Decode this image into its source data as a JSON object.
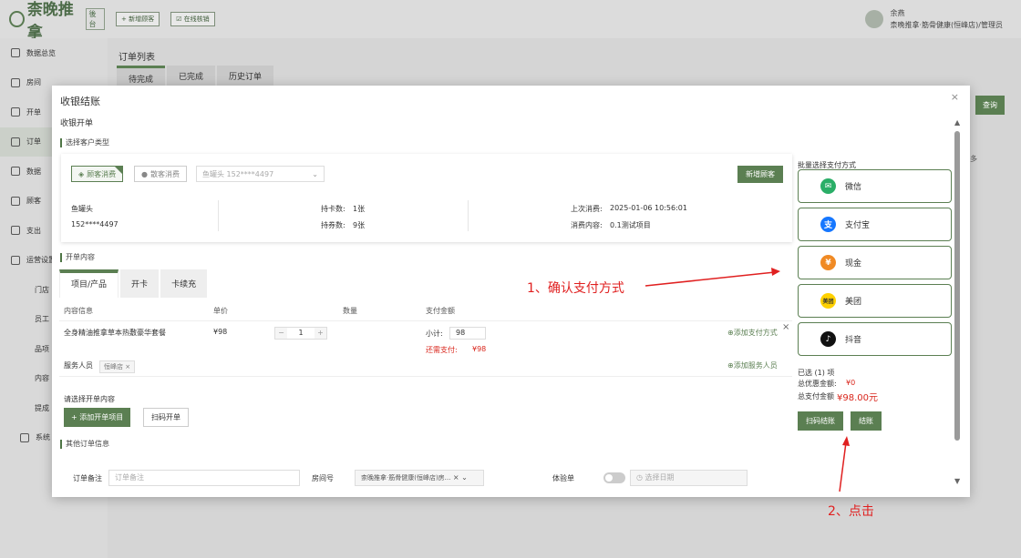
{
  "app": {
    "logo": "柰晚推拿",
    "logo_small": "後台",
    "new_customer": "+ 新增顾客",
    "online_verify": "☑ 在线核销"
  },
  "user": {
    "name": "余燕",
    "store": "柰晚推拿·筋骨健康(恒峰店)/管理员"
  },
  "sidebar": [
    "数据总览",
    "房间",
    "开单",
    "订单",
    "数据",
    "顾客",
    "支出",
    "运营设置",
    "门店",
    "员工",
    "品项",
    "内容",
    "提成",
    "系统"
  ],
  "bg": {
    "title": "订单列表",
    "tabs": [
      "待完成",
      "已完成",
      "历史订单"
    ],
    "query": "查询",
    "dup": "多"
  },
  "modal": {
    "title": "收银结账",
    "close": "×",
    "subtitle": "收银开单",
    "sec_customer": "选择客户类型",
    "member_btn": "顾客消费",
    "guest_btn": "散客消费",
    "customer_select": "鱼罐头 152****4497",
    "new_customer": "新增顾客",
    "cust_name": "鱼罐头",
    "cust_phone": "152****4497",
    "card_label": "持卡数:",
    "card_val": "1张",
    "coupon_label": "持券数:",
    "coupon_val": "9张",
    "last_label": "上次消费:",
    "last_val": "2025-01-06 10:56:01",
    "content_label": "消费内容:",
    "content_val": "0.1测试项目",
    "sec_order": "开单内容",
    "tabs": [
      "项目/产品",
      "开卡",
      "卡续充"
    ],
    "headers": [
      "内容信息",
      "单价",
      "数量",
      "支付金额"
    ],
    "item_name": "全身精油推拿草本热敷豪华套餐",
    "item_price": "¥98",
    "item_qty": "1",
    "subtotal_label": "小计:",
    "subtotal_val": "98",
    "need_label": "还需支付:",
    "need_val": "¥98",
    "add_pay": "⊕添加支付方式",
    "add_staff": "⊕添加服务人员",
    "staff_label": "服务人员",
    "staff_tag": "恒峰店 ×",
    "row_close": "×",
    "choose_label": "请选择开单内容",
    "add_item": "+ 添加开单项目",
    "scan_order": "扫码开单",
    "sec_other": "其他订单信息",
    "remark_label": "订单备注",
    "remark_ph": "订单备注",
    "room_label": "房间号",
    "room_val": "柰晚推拿·筋骨健康(恒峰店)房...",
    "room_clear": "×",
    "room_chev": "⌄",
    "trial_label": "体验单",
    "date_ph": "◷ 选择日期"
  },
  "payment": {
    "title": "批量选择支付方式",
    "methods": [
      {
        "label": "微信",
        "icon": "wechat-icon",
        "color": "#2aae67"
      },
      {
        "label": "支付宝",
        "icon": "alipay-icon",
        "color": "#1677ff"
      },
      {
        "label": "现金",
        "icon": "cash-icon",
        "color": "#f08a24"
      },
      {
        "label": "美团",
        "icon": "meituan-icon",
        "color": "#ffd100"
      },
      {
        "label": "抖音",
        "icon": "douyin-icon",
        "color": "#111111"
      }
    ],
    "selected": "已选 (1) 项",
    "discount_label": "总优惠金额:",
    "discount_val": "¥0",
    "total_label": "总支付金额",
    "total_val": "¥98.00元",
    "scan_pay": "扫码结账",
    "checkout": "结账"
  },
  "annotations": {
    "a1": "1、确认支付方式",
    "a2": "2、点击"
  },
  "colors": {
    "accent": "#5b7f52",
    "annotation": "#e02020"
  }
}
